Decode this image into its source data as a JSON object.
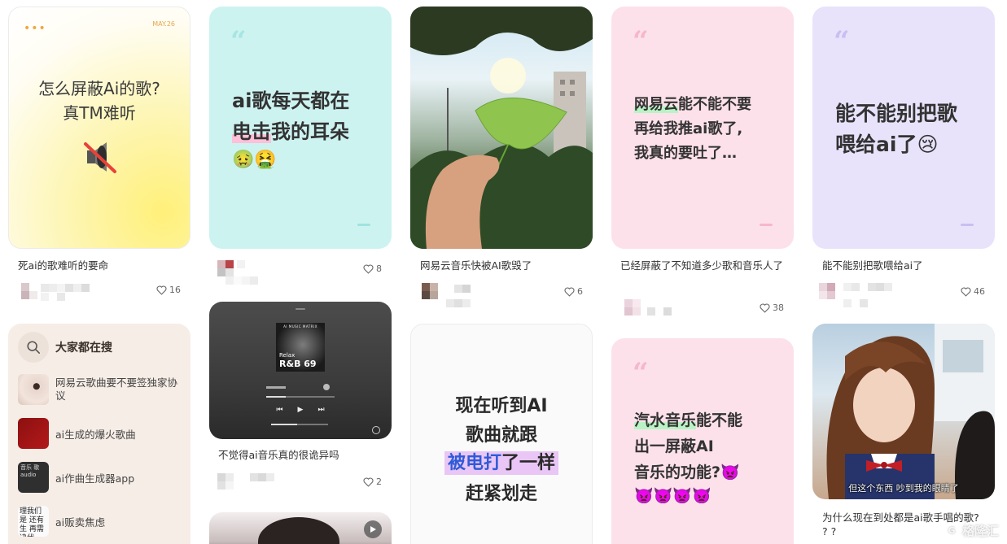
{
  "cards": {
    "c1": {
      "date": "MAY.26",
      "headline_line1": "怎么屏蔽Ai的歌?",
      "headline_line2": "真TM难听",
      "title": "死ai的歌难听的要命",
      "likes": "16"
    },
    "c2": {
      "line1": "ai歌每天都在",
      "line2_hl": "电击",
      "line2_rest": "我的耳朵",
      "emoji": "🤢🤮",
      "likes": "8"
    },
    "c3": {
      "title": "网易云音乐快被AI歌毁了",
      "likes": "6"
    },
    "c4": {
      "line1_hl": "网易云",
      "line1_rest": "能不能不要",
      "line2": "再给我推ai歌了,",
      "line3": "我真的要吐了…",
      "title": "已经屏蔽了不知道多少歌和音乐人了",
      "likes": "38"
    },
    "c5": {
      "line1": "能不能别把歌",
      "line2": "喂给ai了😢",
      "title": "能不能别把歌喂给ai了",
      "likes": "46"
    },
    "search": {
      "heading": "大家都在搜",
      "items": [
        {
          "label": "网易云歌曲要不要签独家协议"
        },
        {
          "label": "ai生成的爆火歌曲"
        },
        {
          "label": "ai作曲生成器app"
        },
        {
          "label": "ai贩卖焦虑"
        }
      ],
      "thumb3_text": "音乐 歌 audio",
      "thumb4_text": "理我们是 还有生 再需决代"
    },
    "c7": {
      "album_header": "AI MUSIC MATRIX",
      "album_line1": "Relax",
      "album_line2": "R&B 69",
      "title": "不觉得ai音乐真的很诡异吗",
      "likes": "2"
    },
    "c8": {
      "line1": "现在听到AI",
      "line2": "歌曲就跟",
      "line3_hl": "被电打",
      "line3_rest": "了一样",
      "line4": "赶紧划走"
    },
    "c9": {
      "line1_hl": "汽水音乐",
      "line1_rest": "能不能",
      "line2": "出一屏蔽AI",
      "line3": "音乐的功能?👿",
      "line4": "👿👿👿👿"
    },
    "c10": {
      "subtitle": "但这个东西 吵到我的眼睛了",
      "title": "为什么现在到处都是ai歌手唱的歌? ? ?"
    }
  },
  "watermark": "格隆汇",
  "colors": {
    "cyan_card": "#cdf3f1",
    "pink_card": "#fde1ea",
    "lavender_card": "#e8e3fb",
    "search_bg": "#f6ede6",
    "quote_cyan": "#a6e6e2",
    "quote_pink": "#f6b7ca",
    "quote_lavender": "#c9bff1"
  }
}
